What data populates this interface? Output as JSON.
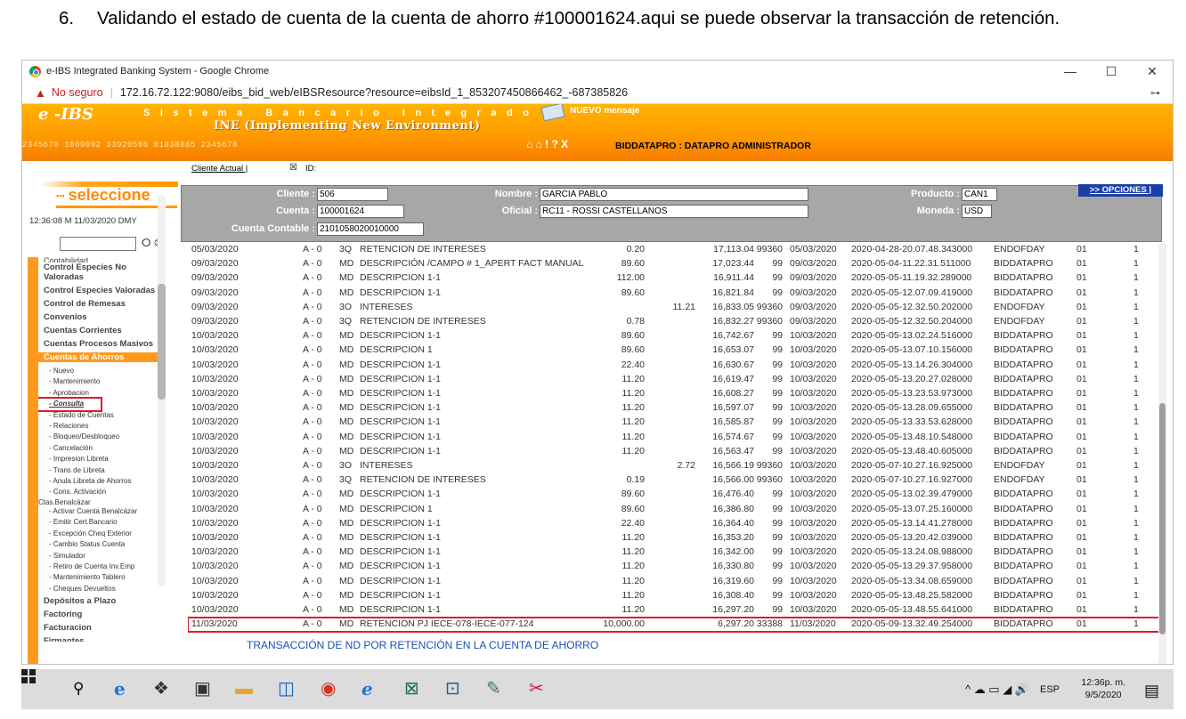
{
  "caption": {
    "number": "6.",
    "text": "Validando el estado de cuenta de la cuenta de ahorro #100001624.aqui se puede observar la transacción de retención."
  },
  "browser": {
    "window_title": "e-IBS Integrated Banking System - Google Chrome",
    "security_label": "No seguro",
    "url": "172.16.72.122:9080/eibs_bid_web/eIBSResource?resource=eibsId_1_853207450866462_-687385826",
    "controls": {
      "minimize": "—",
      "maximize": "☐",
      "close": "✕"
    },
    "key_icon": "key-icon"
  },
  "banner": {
    "logo": "e -IBS",
    "sistema": "Sistema Bancario Integrado",
    "ine": "INE (Implementing New Environment)",
    "numbers": "2345678   1089092   33920586   81038885   2345678",
    "nuevo_mensaje": "NUEVO mensaje",
    "tools": "⌂ ⌂ ! ? X",
    "user": "BIDDATAPRO : DATAPRO ADMINISTRADOR",
    "colors": {
      "banner": "#ff9800",
      "accent": "#e0182d"
    }
  },
  "subbar": {
    "cliente_actual": "Cliente Actual |",
    "x_mark": "☒",
    "id_label": "ID:"
  },
  "sidebar": {
    "title": "seleccione",
    "time": "12:36:08 M      11/03/2020  DMY",
    "go": "⭘ ⊗",
    "cut_item": "Contabilidad",
    "items": [
      {
        "label": "Control Especies No Valoradas",
        "type": "main"
      },
      {
        "label": "Control Especies Valoradas",
        "type": "main"
      },
      {
        "label": "Control de Remesas",
        "type": "main"
      },
      {
        "label": "Convenios",
        "type": "main"
      },
      {
        "label": "Cuentas Corrientes",
        "type": "main"
      },
      {
        "label": "Cuentas Procesos Masivos",
        "type": "main"
      },
      {
        "label": "Cuentas de Ahorros",
        "type": "active"
      }
    ],
    "subitems": [
      "- Nuevo",
      "- Mantenimiento",
      "- Aprobacion",
      "- Consulta",
      "- Estado de Cuentas",
      "- Relaciones",
      "- Bloqueo/Desbloqueo",
      "- Cancelación",
      "- Impresion Libreta",
      "- Trans de Libreta",
      "- Anula Libreta de Ahorros",
      "- Cons. Activación",
      "Ctas.Benalcázar",
      "- Activar Cuenta Benalcázar",
      "- Emitir Cert.Bancario",
      "- Excepción Cheq Exterior",
      "- Cambio Status Cuenta",
      "- Simulador",
      "- Retiro de Cuenta Inv.Emp",
      "- Mantenimiento Tablero",
      "- Cheques Devueltos"
    ],
    "bottom_items": [
      "Depósitos a Plazo",
      "Factoring",
      "Facturacion",
      "Firmantes"
    ]
  },
  "info": {
    "cliente_label": "Cliente :",
    "cliente": "506",
    "nombre_label": "Nombre :",
    "nombre": "GARCIA  PABLO",
    "producto_label": "Producto :",
    "producto": "CAN1",
    "cuenta_label": "Cuenta :",
    "cuenta": "100001624",
    "oficial_label": "Oficial :",
    "oficial": "RC11 - ROSSI CASTELLANOS",
    "moneda_label": "Moneda :",
    "moneda": "USD",
    "contable_label": "Cuenta Contable :",
    "contable": "2101058020010000",
    "opciones": ">> OPCIONES |"
  },
  "transactions": [
    [
      "05/03/2020",
      "A - 0",
      "3Q",
      "RETENCION DE INTERESES",
      "0.20",
      "",
      "17,113.04",
      "99360",
      "05/03/2020",
      "2020-04-28-20.07.48.343000",
      "ENDOFDAY",
      "01",
      "1"
    ],
    [
      "09/03/2020",
      "A - 0",
      "MD",
      "DESCRIPCIÓN /CAMPO # 1_APERT FACT MANUAL",
      "89.60",
      "",
      "17,023.44",
      "99",
      "09/03/2020",
      "2020-05-04-11.22.31.511000",
      "BIDDATAPRO",
      "01",
      "1"
    ],
    [
      "09/03/2020",
      "A - 0",
      "MD",
      "DESCRIPCION 1-1",
      "112.00",
      "",
      "16,911.44",
      "99",
      "09/03/2020",
      "2020-05-05-11.19.32.289000",
      "BIDDATAPRO",
      "01",
      "1"
    ],
    [
      "09/03/2020",
      "A - 0",
      "MD",
      "DESCRIPCION 1-1",
      "89.60",
      "",
      "16,821.84",
      "99",
      "09/03/2020",
      "2020-05-05-12.07.09.419000",
      "BIDDATAPRO",
      "01",
      "1"
    ],
    [
      "09/03/2020",
      "A - 0",
      "3O",
      "INTERESES",
      "",
      "11.21",
      "16,833.05",
      "99360",
      "09/03/2020",
      "2020-05-05-12.32.50.202000",
      "ENDOFDAY",
      "01",
      "1"
    ],
    [
      "09/03/2020",
      "A - 0",
      "3Q",
      "RETENCION DE INTERESES",
      "0.78",
      "",
      "16,832.27",
      "99360",
      "09/03/2020",
      "2020-05-05-12.32.50.204000",
      "ENDOFDAY",
      "01",
      "1"
    ],
    [
      "10/03/2020",
      "A - 0",
      "MD",
      "DESCRIPCION 1-1",
      "89.60",
      "",
      "16,742.67",
      "99",
      "10/03/2020",
      "2020-05-05-13.02.24.516000",
      "BIDDATAPRO",
      "01",
      "1"
    ],
    [
      "10/03/2020",
      "A - 0",
      "MD",
      "DESCRIPCION 1",
      "89.60",
      "",
      "16,653.07",
      "99",
      "10/03/2020",
      "2020-05-05-13.07.10.156000",
      "BIDDATAPRO",
      "01",
      "1"
    ],
    [
      "10/03/2020",
      "A - 0",
      "MD",
      "DESCRIPCION 1-1",
      "22.40",
      "",
      "16,630.67",
      "99",
      "10/03/2020",
      "2020-05-05-13.14.26.304000",
      "BIDDATAPRO",
      "01",
      "1"
    ],
    [
      "10/03/2020",
      "A - 0",
      "MD",
      "DESCRIPCION 1-1",
      "11.20",
      "",
      "16,619.47",
      "99",
      "10/03/2020",
      "2020-05-05-13.20.27.028000",
      "BIDDATAPRO",
      "01",
      "1"
    ],
    [
      "10/03/2020",
      "A - 0",
      "MD",
      "DESCRIPCION 1-1",
      "11.20",
      "",
      "16,608.27",
      "99",
      "10/03/2020",
      "2020-05-05-13.23.53.973000",
      "BIDDATAPRO",
      "01",
      "1"
    ],
    [
      "10/03/2020",
      "A - 0",
      "MD",
      "DESCRIPCION 1-1",
      "11.20",
      "",
      "16,597.07",
      "99",
      "10/03/2020",
      "2020-05-05-13.28.09.655000",
      "BIDDATAPRO",
      "01",
      "1"
    ],
    [
      "10/03/2020",
      "A - 0",
      "MD",
      "DESCRIPCION 1-1",
      "11.20",
      "",
      "16,585.87",
      "99",
      "10/03/2020",
      "2020-05-05-13.33.53.628000",
      "BIDDATAPRO",
      "01",
      "1"
    ],
    [
      "10/03/2020",
      "A - 0",
      "MD",
      "DESCRIPCION 1-1",
      "11.20",
      "",
      "16,574.67",
      "99",
      "10/03/2020",
      "2020-05-05-13.48.10.548000",
      "BIDDATAPRO",
      "01",
      "1"
    ],
    [
      "10/03/2020",
      "A - 0",
      "MD",
      "DESCRIPCION 1-1",
      "11.20",
      "",
      "16,563.47",
      "99",
      "10/03/2020",
      "2020-05-05-13.48.40.605000",
      "BIDDATAPRO",
      "01",
      "1"
    ],
    [
      "10/03/2020",
      "A - 0",
      "3O",
      "INTERESES",
      "",
      "2.72",
      "16,566.19",
      "99360",
      "10/03/2020",
      "2020-05-07-10.27.16.925000",
      "ENDOFDAY",
      "01",
      "1"
    ],
    [
      "10/03/2020",
      "A - 0",
      "3Q",
      "RETENCION DE INTERESES",
      "0.19",
      "",
      "16,566.00",
      "99360",
      "10/03/2020",
      "2020-05-07-10.27.16.927000",
      "ENDOFDAY",
      "01",
      "1"
    ],
    [
      "10/03/2020",
      "A - 0",
      "MD",
      "DESCRIPCION 1-1",
      "89.60",
      "",
      "16,476.40",
      "99",
      "10/03/2020",
      "2020-05-05-13.02.39.479000",
      "BIDDATAPRO",
      "01",
      "1"
    ],
    [
      "10/03/2020",
      "A - 0",
      "MD",
      "DESCRIPCION 1",
      "89.60",
      "",
      "16,386.80",
      "99",
      "10/03/2020",
      "2020-05-05-13.07.25.160000",
      "BIDDATAPRO",
      "01",
      "1"
    ],
    [
      "10/03/2020",
      "A - 0",
      "MD",
      "DESCRIPCION 1-1",
      "22.40",
      "",
      "16,364.40",
      "99",
      "10/03/2020",
      "2020-05-05-13.14.41.278000",
      "BIDDATAPRO",
      "01",
      "1"
    ],
    [
      "10/03/2020",
      "A - 0",
      "MD",
      "DESCRIPCION 1-1",
      "11.20",
      "",
      "16,353.20",
      "99",
      "10/03/2020",
      "2020-05-05-13.20.42.039000",
      "BIDDATAPRO",
      "01",
      "1"
    ],
    [
      "10/03/2020",
      "A - 0",
      "MD",
      "DESCRIPCION 1-1",
      "11.20",
      "",
      "16,342.00",
      "99",
      "10/03/2020",
      "2020-05-05-13.24.08.988000",
      "BIDDATAPRO",
      "01",
      "1"
    ],
    [
      "10/03/2020",
      "A - 0",
      "MD",
      "DESCRIPCION 1-1",
      "11.20",
      "",
      "16,330.80",
      "99",
      "10/03/2020",
      "2020-05-05-13.29.37.958000",
      "BIDDATAPRO",
      "01",
      "1"
    ],
    [
      "10/03/2020",
      "A - 0",
      "MD",
      "DESCRIPCION 1-1",
      "11.20",
      "",
      "16,319.60",
      "99",
      "10/03/2020",
      "2020-05-05-13.34.08.659000",
      "BIDDATAPRO",
      "01",
      "1"
    ],
    [
      "10/03/2020",
      "A - 0",
      "MD",
      "DESCRIPCION 1-1",
      "11.20",
      "",
      "16,308.40",
      "99",
      "10/03/2020",
      "2020-05-05-13.48.25.582000",
      "BIDDATAPRO",
      "01",
      "1"
    ],
    [
      "10/03/2020",
      "A - 0",
      "MD",
      "DESCRIPCION 1-1",
      "11.20",
      "",
      "16,297.20",
      "99",
      "10/03/2020",
      "2020-05-05-13.48.55.641000",
      "BIDDATAPRO",
      "01",
      "1"
    ],
    [
      "11/03/2020",
      "A - 0",
      "MD",
      "RETENCION PJ IECE-078-IECE-077-124",
      "10,000.00",
      "",
      "6,297.20",
      "33388",
      "11/03/2020",
      "2020-05-09-13.32.49.254000",
      "BIDDATAPRO",
      "01",
      "1"
    ]
  ],
  "highlighted_row_index": 26,
  "annotation": "TRANSACCIÓN DE ND POR RETENCIÓN EN LA CUENTA DE AHORRO",
  "taskbar": {
    "apps": [
      "search-icon",
      "edge-icon",
      "dropbox-icon",
      "store-icon",
      "file-explorer-icon",
      "outlook-icon",
      "chrome-icon",
      "ie-icon",
      "excel-icon",
      "word-icon",
      "paint-icon",
      "snipping-icon"
    ],
    "tray_icons": "^ ☁ ▭ ◢ 🔊",
    "lang": "ESP",
    "time": "12:36p. m.",
    "date": "9/5/2020",
    "notifications": "10"
  }
}
